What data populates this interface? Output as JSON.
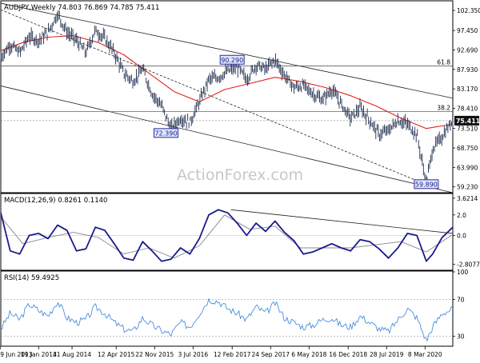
{
  "watermark": "ActionForex.com",
  "chart_data": {
    "type": "line",
    "panels": {
      "price": {
        "header": "AUDJPY,Weekly  74.803 76.869 74.785 75.411",
        "ylim": [
          58.0,
          104.5
        ],
        "yticks": [
          102.35,
          97.45,
          92.69,
          87.93,
          83.17,
          78.41,
          73.51,
          68.75,
          63.99,
          59.23
        ],
        "ytick_labels": [
          "102.350",
          "97.450",
          "92.690",
          "87.930",
          "83.170",
          "78.410",
          "73.510",
          "68.750",
          "63.990",
          "59.230"
        ],
        "last_price": 75.411,
        "last_price_label": "75.411",
        "fib_levels": [
          {
            "label": "61.8",
            "value": 88.8
          },
          {
            "label": "38.2",
            "value": 77.6
          }
        ],
        "annotations": [
          {
            "label": "90.290",
            "x": 2017.12,
            "y": 90.29
          },
          {
            "label": "72.390",
            "x": 2016.07,
            "y": 72.39
          },
          {
            "label": "59.890",
            "x": 2020.2,
            "y": 59.89
          }
        ],
        "channel_upper": [
          [
            2013.45,
            104.1
          ],
          [
            2020.62,
            80.9
          ]
        ],
        "channel_lower": [
          [
            2013.45,
            83.9
          ],
          [
            2020.62,
            57.8
          ]
        ],
        "dotted_trend": [
          [
            2013.45,
            102.5
          ],
          [
            2020.2,
            59.8
          ]
        ],
        "sma": {
          "name": "SMA",
          "x": [
            2013.45,
            2013.8,
            2014.2,
            2014.6,
            2015.0,
            2015.4,
            2015.8,
            2016.2,
            2016.6,
            2017.0,
            2017.4,
            2017.8,
            2018.2,
            2018.6,
            2019.0,
            2019.4,
            2019.8,
            2020.2,
            2020.6
          ],
          "y": [
            92.5,
            94.5,
            95.8,
            96.2,
            94.5,
            91.5,
            87.0,
            82.5,
            80.0,
            83.0,
            84.5,
            86.0,
            85.0,
            83.5,
            81.5,
            79.0,
            76.0,
            73.5,
            74.5
          ]
        },
        "price": {
          "name": "AUDJPY",
          "x": [
            2013.45,
            2013.6,
            2013.75,
            2013.9,
            2014.05,
            2014.2,
            2014.35,
            2014.5,
            2014.65,
            2014.8,
            2014.95,
            2015.1,
            2015.25,
            2015.4,
            2015.55,
            2015.7,
            2015.85,
            2016.0,
            2016.15,
            2016.3,
            2016.45,
            2016.6,
            2016.75,
            2016.9,
            2017.05,
            2017.2,
            2017.35,
            2017.5,
            2017.65,
            2017.8,
            2017.95,
            2018.1,
            2018.25,
            2018.4,
            2018.55,
            2018.7,
            2018.85,
            2019.0,
            2019.15,
            2019.3,
            2019.45,
            2019.6,
            2019.75,
            2019.9,
            2020.05,
            2020.2,
            2020.3,
            2020.45,
            2020.62
          ],
          "y": [
            91.0,
            94.0,
            92.0,
            96.0,
            95.0,
            97.0,
            101.5,
            97.0,
            95.0,
            92.0,
            97.5,
            95.5,
            92.0,
            87.0,
            85.0,
            88.0,
            82.0,
            79.0,
            73.5,
            76.0,
            75.0,
            80.0,
            85.5,
            86.0,
            87.5,
            88.5,
            85.5,
            89.0,
            88.0,
            90.3,
            86.5,
            83.5,
            84.0,
            82.0,
            80.5,
            83.0,
            79.5,
            76.0,
            78.5,
            75.5,
            72.0,
            73.0,
            75.5,
            74.5,
            72.0,
            60.0,
            68.5,
            71.5,
            75.4
          ]
        }
      },
      "macd": {
        "header": "MACD(12,26,9)  0.8261 0.1140",
        "ylim": [
          -3.3,
          4.0
        ],
        "yticks": [
          3.6214,
          2.0,
          0.0,
          -2.8077
        ],
        "ytick_labels": [
          "3.6214",
          "2.0",
          "0.0",
          "-2.8077"
        ],
        "trendline": [
          [
            2017.1,
            2.5
          ],
          [
            2020.62,
            0.2
          ]
        ],
        "macd": {
          "name": "MACD",
          "x": [
            2013.45,
            2013.6,
            2013.75,
            2013.9,
            2014.05,
            2014.2,
            2014.35,
            2014.5,
            2014.65,
            2014.8,
            2014.95,
            2015.1,
            2015.25,
            2015.4,
            2015.55,
            2015.7,
            2015.85,
            2016.0,
            2016.15,
            2016.3,
            2016.45,
            2016.6,
            2016.75,
            2016.9,
            2017.05,
            2017.2,
            2017.35,
            2017.5,
            2017.65,
            2017.8,
            2017.95,
            2018.1,
            2018.25,
            2018.4,
            2018.55,
            2018.7,
            2018.85,
            2019.0,
            2019.15,
            2019.3,
            2019.45,
            2019.6,
            2019.75,
            2019.9,
            2020.05,
            2020.2,
            2020.3,
            2020.45,
            2020.62
          ],
          "y": [
            2.2,
            -1.5,
            -1.8,
            0.0,
            0.2,
            -0.3,
            1.0,
            0.5,
            -1.5,
            -1.3,
            0.8,
            0.5,
            -0.8,
            -2.2,
            -2.4,
            -0.6,
            -1.5,
            -2.5,
            -2.3,
            -1.2,
            -1.8,
            -0.3,
            2.0,
            2.5,
            2.2,
            1.2,
            0.0,
            1.2,
            0.4,
            1.4,
            0.3,
            -0.5,
            -1.8,
            -1.6,
            -1.2,
            -0.8,
            -1.2,
            -1.5,
            -0.4,
            -0.6,
            -1.3,
            -2.2,
            -1.2,
            0.2,
            0.0,
            -2.5,
            -1.8,
            -0.2,
            0.8
          ]
        },
        "signal": {
          "name": "Signal",
          "x": [
            2013.45,
            2013.8,
            2014.2,
            2014.6,
            2015.0,
            2015.4,
            2015.8,
            2016.2,
            2016.6,
            2017.0,
            2017.4,
            2017.8,
            2018.2,
            2018.6,
            2019.0,
            2019.4,
            2019.8,
            2020.2,
            2020.62
          ],
          "y": [
            1.8,
            -0.8,
            -0.2,
            0.3,
            -0.2,
            -1.8,
            -1.2,
            -2.2,
            -1.0,
            2.0,
            0.6,
            0.9,
            -1.2,
            -1.2,
            -1.2,
            -0.9,
            -0.6,
            -1.6,
            0.1
          ]
        }
      },
      "rsi": {
        "header": "RSI(14) 59.4925",
        "ylim": [
          20,
          100
        ],
        "yticks": [
          100,
          70,
          30
        ],
        "ytick_labels": [
          "100",
          "70",
          "30"
        ],
        "rsi": {
          "name": "RSI",
          "x": [
            2013.45,
            2013.6,
            2013.75,
            2013.9,
            2014.05,
            2014.2,
            2014.35,
            2014.5,
            2014.65,
            2014.8,
            2014.95,
            2015.1,
            2015.25,
            2015.4,
            2015.55,
            2015.7,
            2015.85,
            2016.0,
            2016.15,
            2016.3,
            2016.45,
            2016.6,
            2016.75,
            2016.9,
            2017.05,
            2017.2,
            2017.35,
            2017.5,
            2017.65,
            2017.8,
            2017.95,
            2018.1,
            2018.25,
            2018.4,
            2018.55,
            2018.7,
            2018.85,
            2019.0,
            2019.15,
            2019.3,
            2019.45,
            2019.6,
            2019.75,
            2019.9,
            2020.05,
            2020.2,
            2020.3,
            2020.45,
            2020.62
          ],
          "y": [
            38,
            55,
            48,
            65,
            58,
            52,
            68,
            50,
            45,
            48,
            62,
            55,
            45,
            38,
            35,
            50,
            42,
            36,
            32,
            45,
            40,
            55,
            70,
            68,
            60,
            55,
            48,
            62,
            55,
            66,
            50,
            45,
            40,
            42,
            48,
            50,
            42,
            40,
            52,
            45,
            38,
            35,
            48,
            60,
            50,
            25,
            40,
            55,
            59.5
          ]
        }
      }
    },
    "xaxis": {
      "range": [
        2013.45,
        2020.62
      ],
      "ticks": [
        2013.44,
        2014.05,
        2014.58,
        2015.28,
        2015.89,
        2016.5,
        2017.12,
        2017.73,
        2018.34,
        2018.96,
        2019.57,
        2020.18
      ],
      "tick_labels": [
        "9 Jun 2013",
        "19 Jan 2014",
        "31 Aug 2014",
        "12 Apr 2015",
        "22 Nov 2015",
        "3 Jul 2016",
        "12 Feb 2017",
        "24 Sep 2017",
        "6 May 2018",
        "16 Dec 2018",
        "28 Jul 2019",
        "8 Mar 2020"
      ]
    },
    "colors": {
      "bars": "#1f2d4e",
      "sma": "#e02020",
      "macd": "#1a1a8c",
      "signal": "#888888",
      "rsi": "#4a8ee0",
      "label_box_border": "#2a2a9a",
      "label_box_fill": "#dfe6fb",
      "fib": "#444444",
      "last_price_bg": "#111111"
    }
  }
}
